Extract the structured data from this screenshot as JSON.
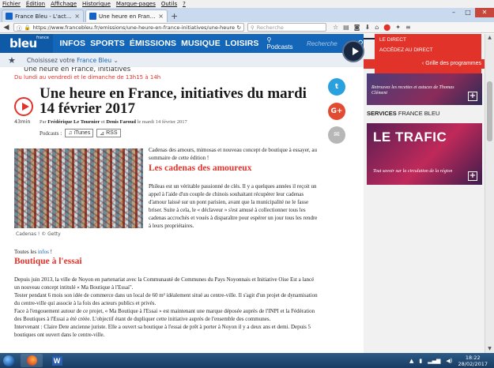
{
  "menubar": {
    "items": [
      "Fichier",
      "Édition",
      "Affichage",
      "Historique",
      "Marque-pages",
      "Outils",
      "?"
    ]
  },
  "tabs": [
    {
      "label": "France Bleu - L'actualité en..."
    },
    {
      "label": "Une heure en France, initia..."
    }
  ],
  "navbar": {
    "url": "https://www.francebleu.fr/emissions/une-heure-en-france-initiatives/une-heure-en-",
    "search_placeholder": "Recherche"
  },
  "site": {
    "logo_small": "france",
    "logo_big": "bleu",
    "nav": [
      "INFOS",
      "SPORTS",
      "ÉMISSIONS",
      "MUSIQUE",
      "LOISIRS"
    ],
    "podcasts": "Podcasts",
    "search_placeholder": "Recherche",
    "choose_prefix": "Choisissez votre",
    "choose_station": "France Bleu"
  },
  "article": {
    "cut_heading": "Une heure en France, initiatives",
    "schedule": "Du lundi au vendredi et le dimanche de 13h15 à 14h",
    "title": "Une heure en France, initiatives du mardi 14 février 2017",
    "duration": "43min",
    "by_prefix": "Par",
    "author1": "Frédérique Le Tournier",
    "by_and": "et",
    "author2": "Denis Faroud",
    "date": "le mardi 14 février 2017",
    "podcasts_label": "Podcasts :",
    "itunes": "iTunes",
    "rss": "RSS",
    "photo_caption": "Cadenas ! © Getty",
    "intro": "Cadenas des amours, mimosas et nouveau concept de boutique à essayer, au sommaire de cette édition !",
    "h_cadenas": "Les cadenas des amoureux",
    "para_cadenas": "Phileas est un véritable passionné de clés. Il y a quelques années il reçoit un appel à l'aide d'un couple de chinois souhaitant récupérer leur cadenas d'amour laissé sur un pont parisien, avant que la municipalité ne le fasse briser. Suite à cela, le « déclaveur » s'est amusé à collectionner tous les cadenas accrochés et voués à disparaître pour espérer un jour tous les rendre à leurs propriétaires.",
    "infos_prefix": "Toutes les",
    "infos_link": "infos",
    "infos_suffix": "!",
    "h_boutique": "Boutique à l'essai",
    "para_boutique": [
      "Depuis juin 2013, la ville de Noyon en partenariat avec la Communauté de Communes du Pays Noyonnais et Initiative Oise Est a lancé un nouveau concept intitulé « Ma Boutique à l'Essai\".",
      "Tester pendant 6 mois son idée de commerce dans un local de 60 m² idéalement situé au centre-ville. Il s'agit d'un projet de dynamisation du centre-ville qui associe à la fois des acteurs publics et privés.",
      "Face à l'engouement autour de ce projet, « Ma Boutique à l'Essai » est maintenant une marque déposée auprès de l'INPI et la Fédération des Boutiques à l'Essai a été créée. L'objectif étant de dupliquer cette initiative auprès de l'ensemble des communes.",
      "Intervenant : Claire Dete ancienne juriste. Elle a ouvert sa boutique à l'essai de prêt à porter à Noyon il y a deux ans et demi. Depuis 5 boutiques ont ouvert dans le centre-ville."
    ]
  },
  "share": {
    "twitter": "t",
    "facebook": "f",
    "gplus": "G+",
    "mail": "✉"
  },
  "sidebar": {
    "direct_title": "LE DIRECT",
    "direct_sub": "ACCÉDEZ AU DIRECT",
    "grille": "‹ Grille des programmes",
    "tile1_text": "Retrouvez les recettes et astuces de Thomas Clément",
    "services_a": "SERVICES",
    "services_b": "FRANCE BLEU",
    "trafic": "LE TRAFIC",
    "trafic_text": "Tout savoir sur la circulation de la région"
  },
  "taskbar": {
    "time": "18:22",
    "date": "28/02/2017",
    "word_letter": "W"
  }
}
